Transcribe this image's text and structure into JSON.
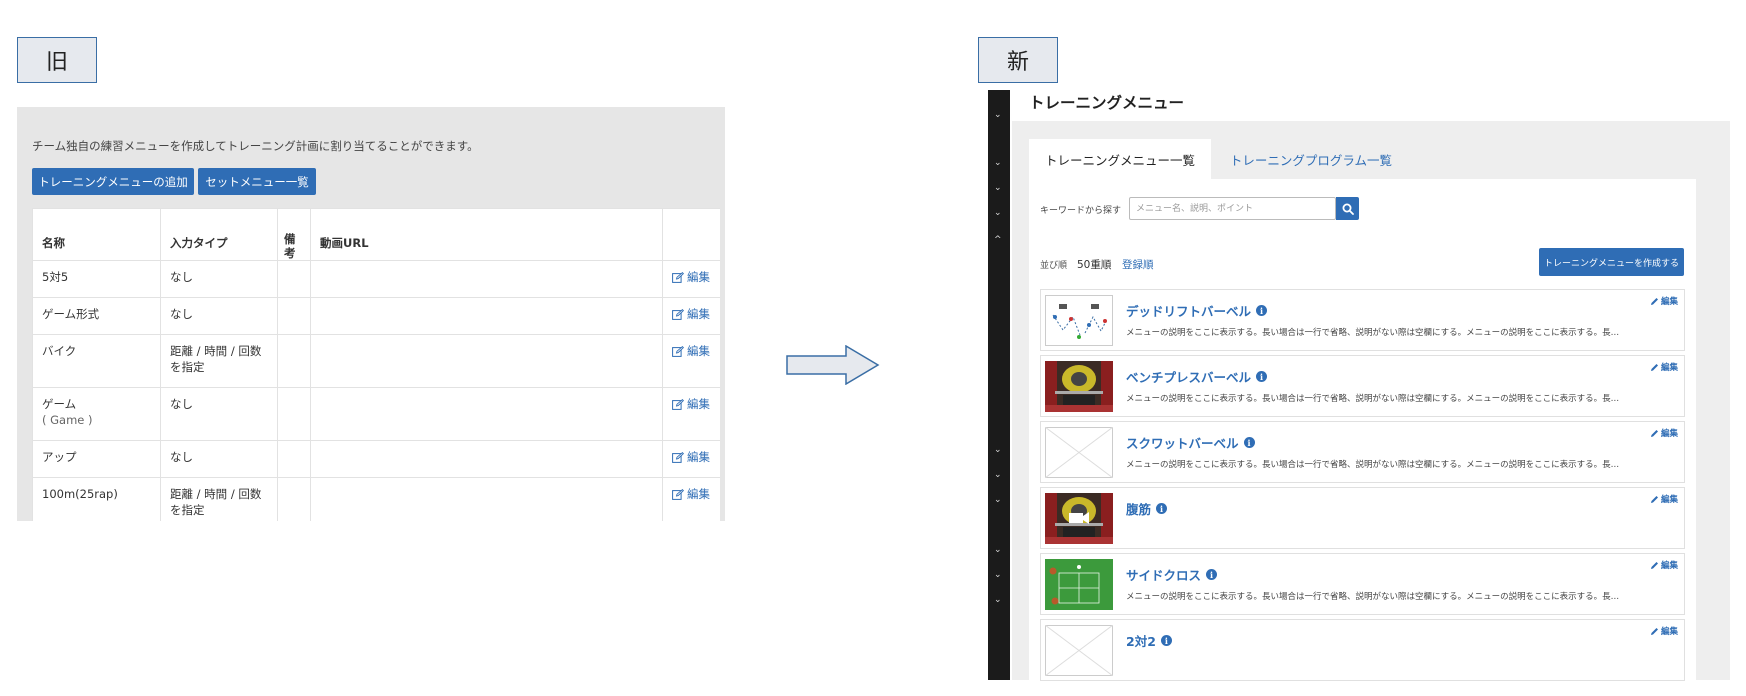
{
  "labels": {
    "old": "旧",
    "new": "新"
  },
  "old": {
    "description": "チーム独自の練習メニューを作成してトレーニング計画に割り当てることができます。",
    "add_button": "トレーニングメニューの追加",
    "set_button": "セットメニュー一覧",
    "columns": [
      "名称",
      "入力タイプ",
      "備考",
      "動画URL"
    ],
    "edit_label": "編集",
    "rows": [
      {
        "name": "5対5",
        "sub": "",
        "type": "なし"
      },
      {
        "name": "ゲーム形式",
        "sub": "",
        "type": "なし"
      },
      {
        "name": "バイク",
        "sub": "",
        "type": "距離 / 時間 / 回数を指定"
      },
      {
        "name": "ゲーム",
        "sub": "( Game )",
        "type": "なし"
      },
      {
        "name": "アップ",
        "sub": "",
        "type": "なし"
      },
      {
        "name": "100m(25rap)",
        "sub": "",
        "type": "距離 / 時間 / 回数を指定"
      }
    ]
  },
  "new": {
    "title": "トレーニングメニュー",
    "tabs": [
      "トレーニングメニュー一覧",
      "トレーニングプログラム一覧"
    ],
    "search_label": "キーワードから探す",
    "search_placeholder": "メニュー名、説明、ポイント",
    "sort_label": "並び順",
    "sort_options": [
      "50重順",
      "登録順"
    ],
    "create_button": "トレーニングメニューを作成する",
    "edit_label": "編集",
    "cards": [
      {
        "title": "デッドリフトバーベル",
        "desc": "メニューの説明をここに表示する。長い場合は一行で省略、説明がない際は空欄にする。メニューの説明をここに表示する。長…",
        "thumb": "diagram"
      },
      {
        "title": "ベンチプレスバーベル",
        "desc": "メニューの説明をここに表示する。長い場合は一行で省略、説明がない際は空欄にする。メニューの説明をここに表示する。長…",
        "thumb": "photo"
      },
      {
        "title": "スクワットバーベル",
        "desc": "メニューの説明をここに表示する。長い場合は一行で省略、説明がない際は空欄にする。メニューの説明をここに表示する。長…",
        "thumb": "placeholder"
      },
      {
        "title": "腹筋",
        "desc": "",
        "thumb": "video"
      },
      {
        "title": "サイドクロス",
        "desc": "メニューの説明をここに表示する。長い場合は一行で省略、説明がない際は空欄にする。メニューの説明をここに表示する。長…",
        "thumb": "field"
      },
      {
        "title": "2対2",
        "desc": "",
        "thumb": "placeholder"
      }
    ]
  },
  "colors": {
    "primary": "#2f6db5",
    "sidebar": "#1b1b1b",
    "panel_bg": "#e6e6e6"
  }
}
